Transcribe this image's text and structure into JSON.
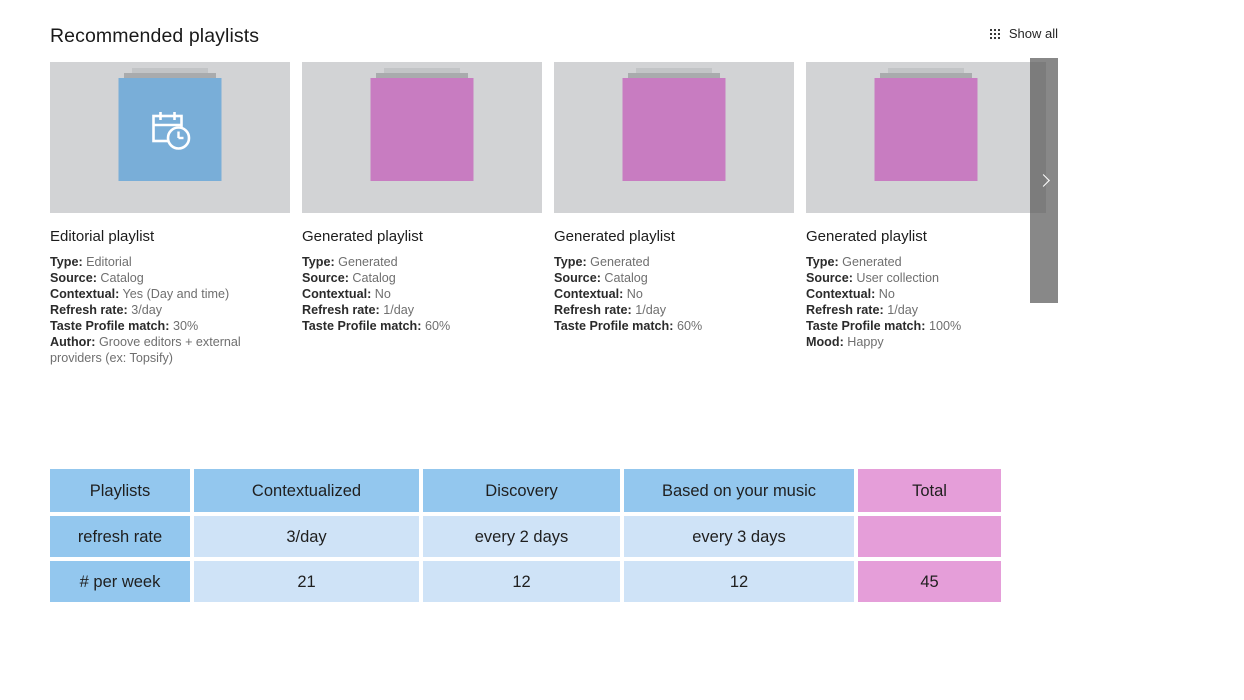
{
  "section": {
    "title": "Recommended playlists",
    "show_all_label": "Show all",
    "show_all_icon": "grid-dots-icon",
    "next_icon": "chevron-right-icon"
  },
  "cards": [
    {
      "title": "Editorial playlist",
      "thumb_color": "#79aed8",
      "icon": "calendar-clock-icon",
      "meta": [
        {
          "key": "Type:",
          "value": "Editorial"
        },
        {
          "key": "Source:",
          "value": "Catalog"
        },
        {
          "key": "Contextual:",
          "value": "Yes (Day and time)"
        },
        {
          "key": "Refresh rate:",
          "value": "3/day"
        },
        {
          "key": "Taste Profile match:",
          "value": "30%"
        },
        {
          "key": "Author:",
          "value": "Groove editors + external providers (ex: Topsify)"
        }
      ]
    },
    {
      "title": "Generated playlist",
      "thumb_color": "#c87cc1",
      "icon": "",
      "meta": [
        {
          "key": "Type:",
          "value": "Generated"
        },
        {
          "key": "Source:",
          "value": "Catalog"
        },
        {
          "key": "Contextual:",
          "value": "No"
        },
        {
          "key": "Refresh rate:",
          "value": "1/day"
        },
        {
          "key": "Taste Profile match:",
          "value": "60%"
        }
      ]
    },
    {
      "title": "Generated playlist",
      "thumb_color": "#c87cc1",
      "icon": "",
      "meta": [
        {
          "key": "Type:",
          "value": "Generated"
        },
        {
          "key": "Source:",
          "value": "Catalog"
        },
        {
          "key": "Contextual:",
          "value": "No"
        },
        {
          "key": "Refresh rate:",
          "value": "1/day"
        },
        {
          "key": "Taste Profile match:",
          "value": "60%"
        }
      ]
    },
    {
      "title": "Generated playlist",
      "thumb_color": "#c87cc1",
      "icon": "",
      "meta": [
        {
          "key": "Type:",
          "value": "Generated"
        },
        {
          "key": "Source:",
          "value": "User collection"
        },
        {
          "key": "Contextual:",
          "value": "No"
        },
        {
          "key": "Refresh rate:",
          "value": "1/day"
        },
        {
          "key": "Taste Profile match:",
          "value": "100%"
        },
        {
          "key": "Mood:",
          "value": "Happy"
        }
      ]
    }
  ],
  "table": {
    "header": [
      "Playlists",
      "Contextualized",
      "Discovery",
      "Based on your music",
      "Total"
    ],
    "rows": [
      [
        "refresh rate",
        "3/day",
        "every 2 days",
        "every 3 days",
        ""
      ],
      [
        "# per week",
        "21",
        "12",
        "12",
        "45"
      ]
    ],
    "colors": {
      "header_blue": "#93c7ee",
      "body_blue": "#cfe3f7",
      "accent_pink": "#e59ed9"
    }
  }
}
